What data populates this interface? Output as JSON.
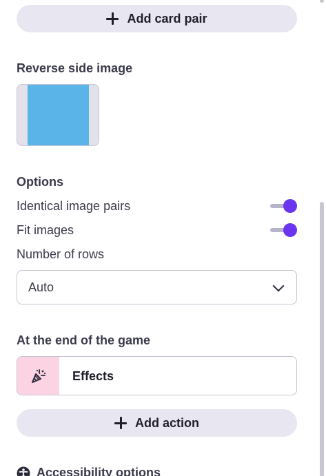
{
  "add_card_pair": {
    "label": "Add card pair"
  },
  "reverse_side": {
    "title": "Reverse side image",
    "image_color": "#5bb4e8"
  },
  "options": {
    "title": "Options",
    "identical_pairs": {
      "label": "Identical image pairs",
      "on": true
    },
    "fit_images": {
      "label": "Fit images",
      "on": true
    },
    "rows": {
      "label": "Number of rows",
      "value": "Auto"
    }
  },
  "end_of_game": {
    "title": "At the end of the game",
    "effects_label": "Effects",
    "effects_icon": "party-popper-icon"
  },
  "add_action": {
    "label": "Add action"
  },
  "accessibility": {
    "label": "Accessibility options",
    "icon": "accessibility-icon"
  },
  "colors": {
    "accent": "#6b35f0",
    "button_bg": "#e8e6f0",
    "effects_bg": "#fbd3e3"
  }
}
